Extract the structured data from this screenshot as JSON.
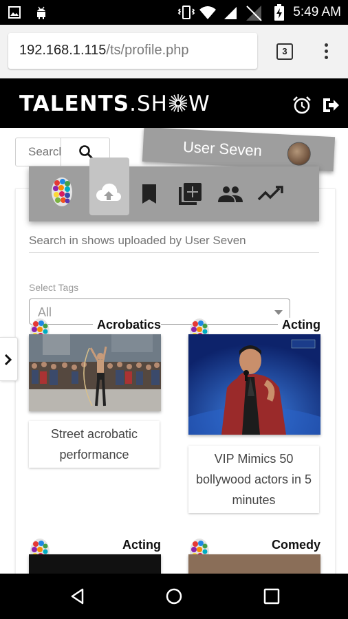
{
  "status_bar": {
    "time": "5:49 AM",
    "icons": [
      "image-icon",
      "android-icon",
      "vibrate-icon",
      "wifi-icon",
      "signal-icon",
      "no-signal-icon",
      "battery-charging-icon"
    ]
  },
  "browser": {
    "url_host": "192.168.1.115",
    "url_path": "/ts/profile.php",
    "tab_count": "3"
  },
  "site": {
    "logo_bold": "TALENTS",
    "logo_dot": ".",
    "logo_thin_1": "SH",
    "logo_thin_2": "W",
    "header_icons": [
      "alarm-icon",
      "logout-icon"
    ]
  },
  "user_search": {
    "placeholder": "Search"
  },
  "profile": {
    "user_name": "User Seven"
  },
  "toolbar": {
    "items": [
      "avatar",
      "upload-icon",
      "bookmark-icon",
      "add-to-library-icon",
      "people-icon",
      "trending-icon"
    ],
    "active": "upload-icon"
  },
  "shows_search": {
    "placeholder": "Search in shows uploaded by User Seven"
  },
  "tags": {
    "label": "Select Tags",
    "selected": "All"
  },
  "shows": [
    {
      "category": "Acrobatics",
      "title": "Street acrobatic performance"
    },
    {
      "category": "Acting",
      "title": "VIP Mimics 50 bollywood actors in 5 minutes"
    },
    {
      "category": "Acting",
      "title": ""
    },
    {
      "category": "Comedy",
      "title": ""
    }
  ],
  "colors": {
    "toolbar_bg": "#9e9e9e",
    "header_bg": "#000000",
    "stage_blue": "#1a3f9c",
    "jacket_red": "#9a2a2a"
  }
}
